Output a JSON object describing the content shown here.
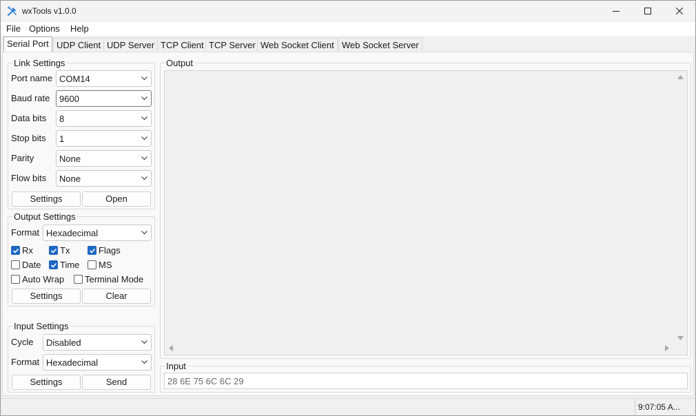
{
  "window": {
    "title": "wxTools v1.0.0"
  },
  "icons": {
    "app": "tools-icon",
    "minimize": "minimize-icon",
    "maximize": "maximize-icon",
    "close": "close-icon",
    "dropdown": "chevron-down-icon",
    "checkmark": "checkmark-icon"
  },
  "colors": {
    "accent": "#1e68c4",
    "window_bg": "#f0f0f0",
    "panel_bg": "#f9f9f9"
  },
  "menu": [
    "File",
    "Options",
    "Help"
  ],
  "tabs": [
    "Serial Port",
    "UDP Client",
    "UDP Server",
    "TCP Client",
    "TCP Server",
    "Web Socket Client",
    "Web Socket Server"
  ],
  "active_tab": "Serial Port",
  "link_settings": {
    "title": "Link Settings",
    "fields": [
      {
        "label": "Port name",
        "value": "COM14"
      },
      {
        "label": "Baud rate",
        "value": "9600"
      },
      {
        "label": "Data bits",
        "value": "8"
      },
      {
        "label": "Stop bits",
        "value": "1"
      },
      {
        "label": "Parity",
        "value": "None"
      },
      {
        "label": "Flow bits",
        "value": "None"
      }
    ],
    "settings_button": "Settings",
    "open_button": "Open"
  },
  "output_settings": {
    "title": "Output Settings",
    "format_label": "Format",
    "format_value": "Hexadecimal",
    "checkboxes": [
      {
        "label": "Rx",
        "checked": true
      },
      {
        "label": "Tx",
        "checked": true
      },
      {
        "label": "Flags",
        "checked": true
      },
      {
        "label": "Date",
        "checked": false
      },
      {
        "label": "Time",
        "checked": true
      },
      {
        "label": "MS",
        "checked": false
      },
      {
        "label": "Auto Wrap",
        "checked": false
      },
      {
        "label": "Terminal Mode",
        "checked": false
      }
    ],
    "settings_button": "Settings",
    "clear_button": "Clear"
  },
  "input_settings": {
    "title": "Input Settings",
    "cycle_label": "Cycle",
    "cycle_value": "Disabled",
    "format_label": "Format",
    "format_value": "Hexadecimal",
    "settings_button": "Settings",
    "send_button": "Send"
  },
  "output": {
    "title": "Output"
  },
  "input": {
    "title": "Input",
    "value": "28 6E 75 6C 6C 29"
  },
  "status": {
    "text": "9:07:05 A..."
  }
}
